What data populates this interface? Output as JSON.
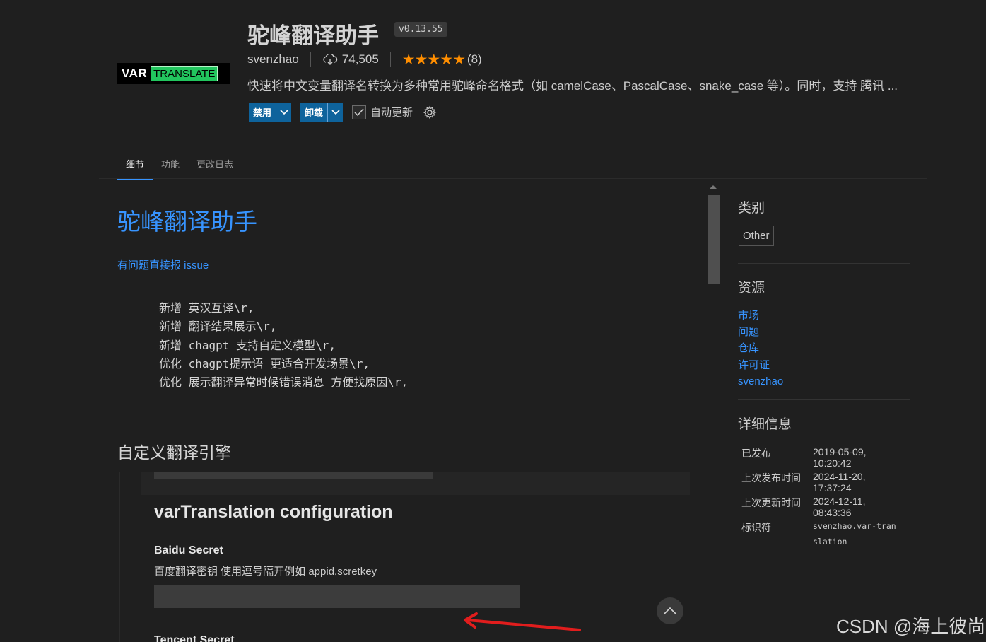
{
  "extension": {
    "logo_text_left": "VAR",
    "logo_text_right": "TRANSLATE",
    "name": "驼峰翻译助手",
    "version": "v0.13.55",
    "publisher": "svenzhao",
    "installs": "74,505",
    "stars": "★★★★★",
    "rating_count": "(8)",
    "description": "快速将中文变量翻译名转换为多种常用驼峰命名格式（如 camelCase、PascalCase、snake_case 等）。同时，支持 腾讯 ..."
  },
  "actions": {
    "disable_label": "禁用",
    "uninstall_label": "卸载",
    "auto_update_label": "自动更新"
  },
  "tabs": [
    "细节",
    "功能",
    "更改日志"
  ],
  "readme": {
    "title": "驼峰翻译助手",
    "issue_link": "有问题直接报 issue",
    "changes": [
      "新增 英汉互译\\r,",
      "新增 翻译结果展示\\r,",
      "新增 chagpt 支持自定义模型\\r,",
      "优化 chagpt提示语 更适合开发场景\\r,",
      "优化 展示翻译异常时候错误消息 方便找原因\\r,"
    ],
    "section_title": "自定义翻译引擎",
    "screenshot": {
      "heading": "varTranslation configuration",
      "baidu_title": "Baidu Secret",
      "baidu_desc": "百度翻译密钥 使用逗号隔开例如 appid,scretkey",
      "tencent_title": "Tencent Secret"
    }
  },
  "sidebar": {
    "categories_title": "类别",
    "category": "Other",
    "resources_title": "资源",
    "resources": [
      "市场",
      "问题",
      "仓库",
      "许可证",
      "svenzhao"
    ],
    "details_title": "详细信息",
    "details": [
      {
        "key": "已发布",
        "value": "2019-05-09, 10:20:42"
      },
      {
        "key": "上次发布时间",
        "value": "2024-11-20, 17:37:24"
      },
      {
        "key": "上次更新时间",
        "value": "2024-12-11, 08:43:36"
      },
      {
        "key": "标识符",
        "value": "svenzhao.var-translation"
      }
    ]
  },
  "watermark": "CSDN @海上彼尚",
  "colors": {
    "background": "#1f1f1f",
    "link": "#3794ff",
    "button": "#0e639c",
    "star": "#ff8e00",
    "arrow": "#e11d1d"
  }
}
